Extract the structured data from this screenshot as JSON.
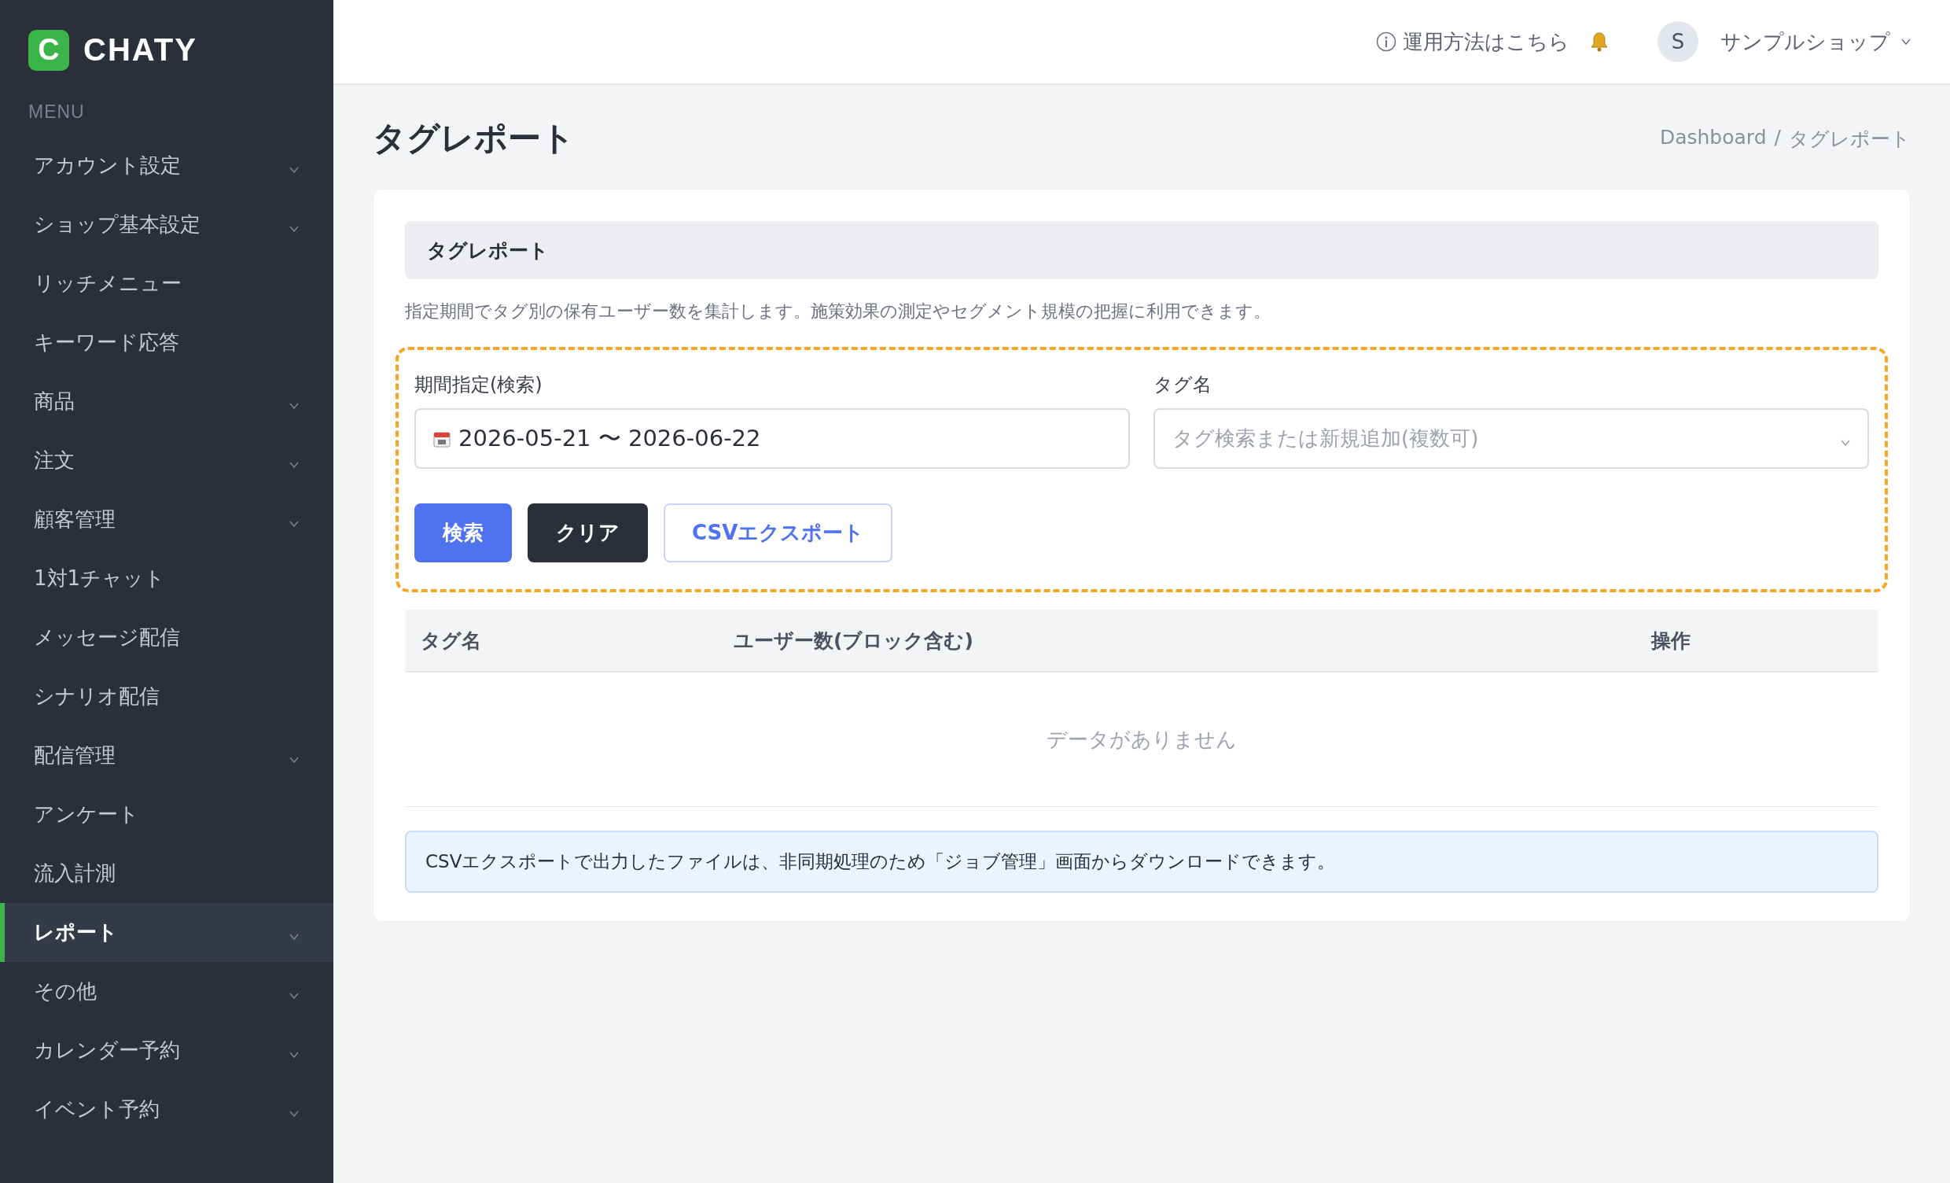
{
  "brand": {
    "logo_letter": "C",
    "name": "CHATY"
  },
  "sidebar": {
    "heading": "MENU",
    "items": [
      {
        "label": "アカウント設定",
        "expandable": true,
        "selected": false
      },
      {
        "label": "ショップ基本設定",
        "expandable": true,
        "selected": false
      },
      {
        "label": "リッチメニュー",
        "expandable": false,
        "selected": false
      },
      {
        "label": "キーワード応答",
        "expandable": false,
        "selected": false
      },
      {
        "label": "商品",
        "expandable": true,
        "selected": false
      },
      {
        "label": "注文",
        "expandable": true,
        "selected": false
      },
      {
        "label": "顧客管理",
        "expandable": true,
        "selected": false
      },
      {
        "label": "1対1チャット",
        "expandable": false,
        "selected": false
      },
      {
        "label": "メッセージ配信",
        "expandable": false,
        "selected": false
      },
      {
        "label": "シナリオ配信",
        "expandable": false,
        "selected": false
      },
      {
        "label": "配信管理",
        "expandable": true,
        "selected": false
      },
      {
        "label": "アンケート",
        "expandable": false,
        "selected": false
      },
      {
        "label": "流入計測",
        "expandable": false,
        "selected": false
      },
      {
        "label": "レポート",
        "expandable": true,
        "selected": true
      },
      {
        "label": "その他",
        "expandable": true,
        "selected": false
      },
      {
        "label": "カレンダー予約",
        "expandable": true,
        "selected": false
      },
      {
        "label": "イベント予約",
        "expandable": true,
        "selected": false
      }
    ]
  },
  "header": {
    "help_link": "運用方法はこちら",
    "avatar_letter": "S",
    "shop_name": "サンプルショップ"
  },
  "page": {
    "title": "タグレポート",
    "breadcrumb": [
      {
        "label": "Dashboard"
      },
      {
        "label": "タグレポート"
      }
    ],
    "breadcrumb_separator": "/"
  },
  "card": {
    "section_title": "タグレポート",
    "description": "指定期間でタグ別の保有ユーザー数を集計します。施策効果の測定やセグメント規模の把握に利用できます。",
    "filters": {
      "period": {
        "label": "期間指定(検索)",
        "value": "2026-05-21 〜 2026-06-22"
      },
      "tag": {
        "label": "タグ名",
        "placeholder": "タグ検索または新規追加(複数可)"
      }
    },
    "buttons": [
      {
        "label": "検索",
        "kind": "primary"
      },
      {
        "label": "クリア",
        "kind": "dark"
      },
      {
        "label": "CSVエクスポート",
        "kind": "outline"
      }
    ],
    "table": {
      "columns": [
        "タグ名",
        "ユーザー数(ブロック含む)",
        "操作"
      ],
      "empty_message": "データがありません"
    },
    "note": "CSVエクスポートで出力したファイルは、非同期処理のため「ジョブ管理」画面からダウンロードできます。"
  }
}
